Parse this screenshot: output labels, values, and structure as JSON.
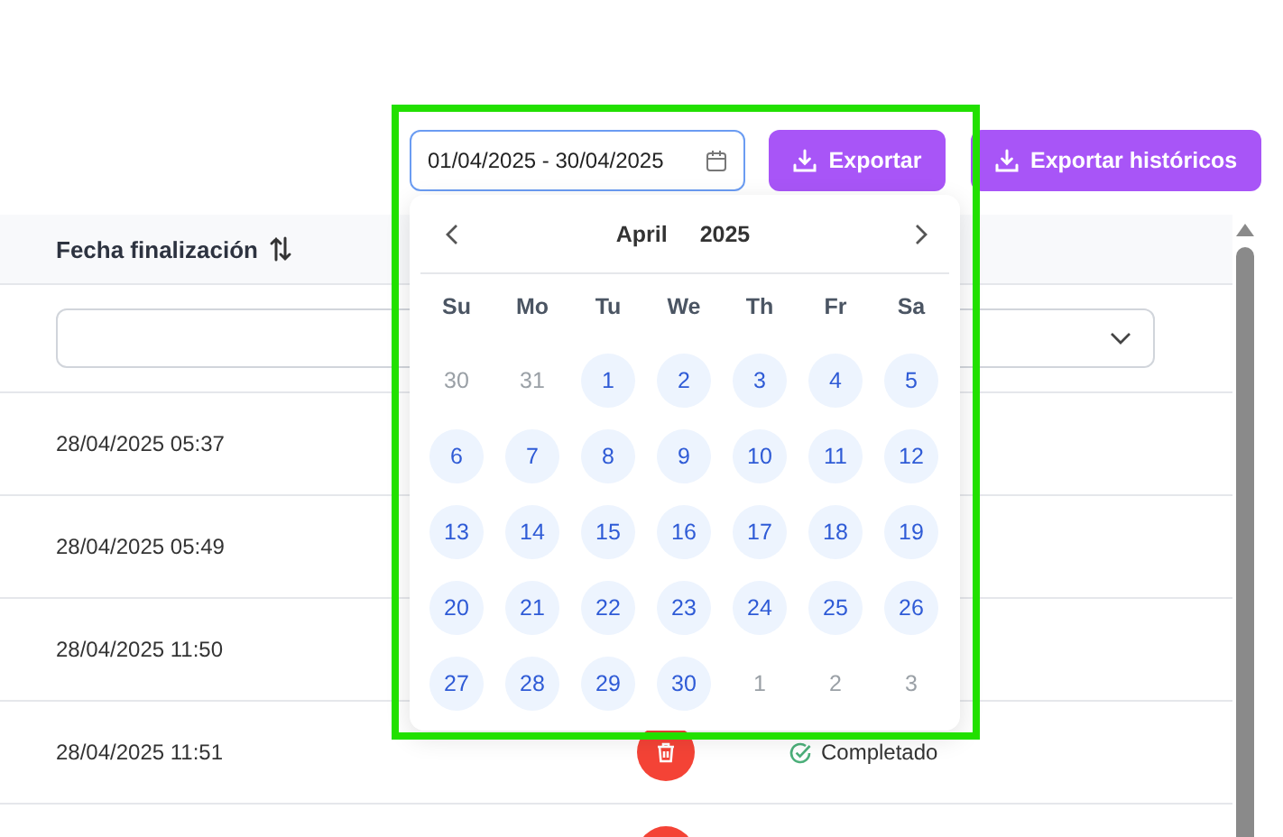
{
  "toolbar": {
    "date_range": {
      "value": "01/04/2025 - 30/04/2025"
    },
    "buttons": [
      {
        "label": "Exportar"
      },
      {
        "label": "Exportar históricos"
      }
    ]
  },
  "table": {
    "columns": [
      {
        "label": "Fecha finalización"
      }
    ],
    "rows": [
      {
        "date": "28/04/2025 05:37"
      },
      {
        "date": "28/04/2025 05:49"
      },
      {
        "date": "28/04/2025 11:50"
      },
      {
        "date": "28/04/2025 11:51",
        "delete": true,
        "status": "Completado"
      },
      {
        "delete": true
      }
    ]
  },
  "calendar": {
    "month": "April",
    "year": "2025",
    "weekdays": [
      "Su",
      "Mo",
      "Tu",
      "We",
      "Th",
      "Fr",
      "Sa"
    ],
    "weeks": [
      [
        {
          "day": "30",
          "in_month": false
        },
        {
          "day": "31",
          "in_month": false
        },
        {
          "day": "1",
          "in_month": true
        },
        {
          "day": "2",
          "in_month": true
        },
        {
          "day": "3",
          "in_month": true
        },
        {
          "day": "4",
          "in_month": true
        },
        {
          "day": "5",
          "in_month": true
        }
      ],
      [
        {
          "day": "6",
          "in_month": true
        },
        {
          "day": "7",
          "in_month": true
        },
        {
          "day": "8",
          "in_month": true
        },
        {
          "day": "9",
          "in_month": true
        },
        {
          "day": "10",
          "in_month": true
        },
        {
          "day": "11",
          "in_month": true
        },
        {
          "day": "12",
          "in_month": true
        }
      ],
      [
        {
          "day": "13",
          "in_month": true
        },
        {
          "day": "14",
          "in_month": true
        },
        {
          "day": "15",
          "in_month": true
        },
        {
          "day": "16",
          "in_month": true
        },
        {
          "day": "17",
          "in_month": true
        },
        {
          "day": "18",
          "in_month": true
        },
        {
          "day": "19",
          "in_month": true
        }
      ],
      [
        {
          "day": "20",
          "in_month": true
        },
        {
          "day": "21",
          "in_month": true
        },
        {
          "day": "22",
          "in_month": true
        },
        {
          "day": "23",
          "in_month": true
        },
        {
          "day": "24",
          "in_month": true
        },
        {
          "day": "25",
          "in_month": true
        },
        {
          "day": "26",
          "in_month": true
        }
      ],
      [
        {
          "day": "27",
          "in_month": true
        },
        {
          "day": "28",
          "in_month": true
        },
        {
          "day": "29",
          "in_month": true
        },
        {
          "day": "30",
          "in_month": true
        },
        {
          "day": "1",
          "in_month": false
        },
        {
          "day": "2",
          "in_month": false
        },
        {
          "day": "3",
          "in_month": false
        }
      ]
    ]
  }
}
